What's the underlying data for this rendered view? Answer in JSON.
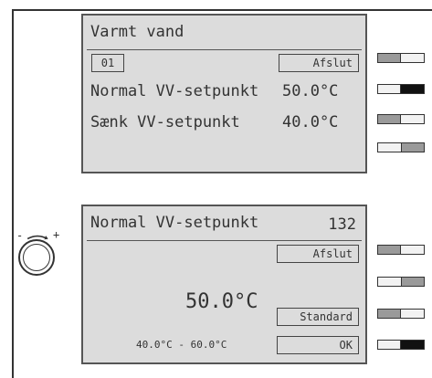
{
  "screen1": {
    "title": "Varmt vand",
    "index": "01",
    "exit_label": "Afslut",
    "rows": [
      {
        "label": "Normal VV-setpunkt",
        "value": "50.0°C"
      },
      {
        "label": "Sænk VV-setpunkt",
        "value": "40.0°C"
      }
    ]
  },
  "screen2": {
    "title": "Normal VV-setpunkt",
    "number": "132",
    "exit_label": "Afslut",
    "value": "50.0°C",
    "range": "40.0°C - 60.0°C",
    "standard_label": "Standard",
    "ok_label": "OK"
  },
  "knob": {
    "minus": "-",
    "plus": "+"
  },
  "icons": [
    "rotary-knob-icon",
    "arrow-icon"
  ]
}
